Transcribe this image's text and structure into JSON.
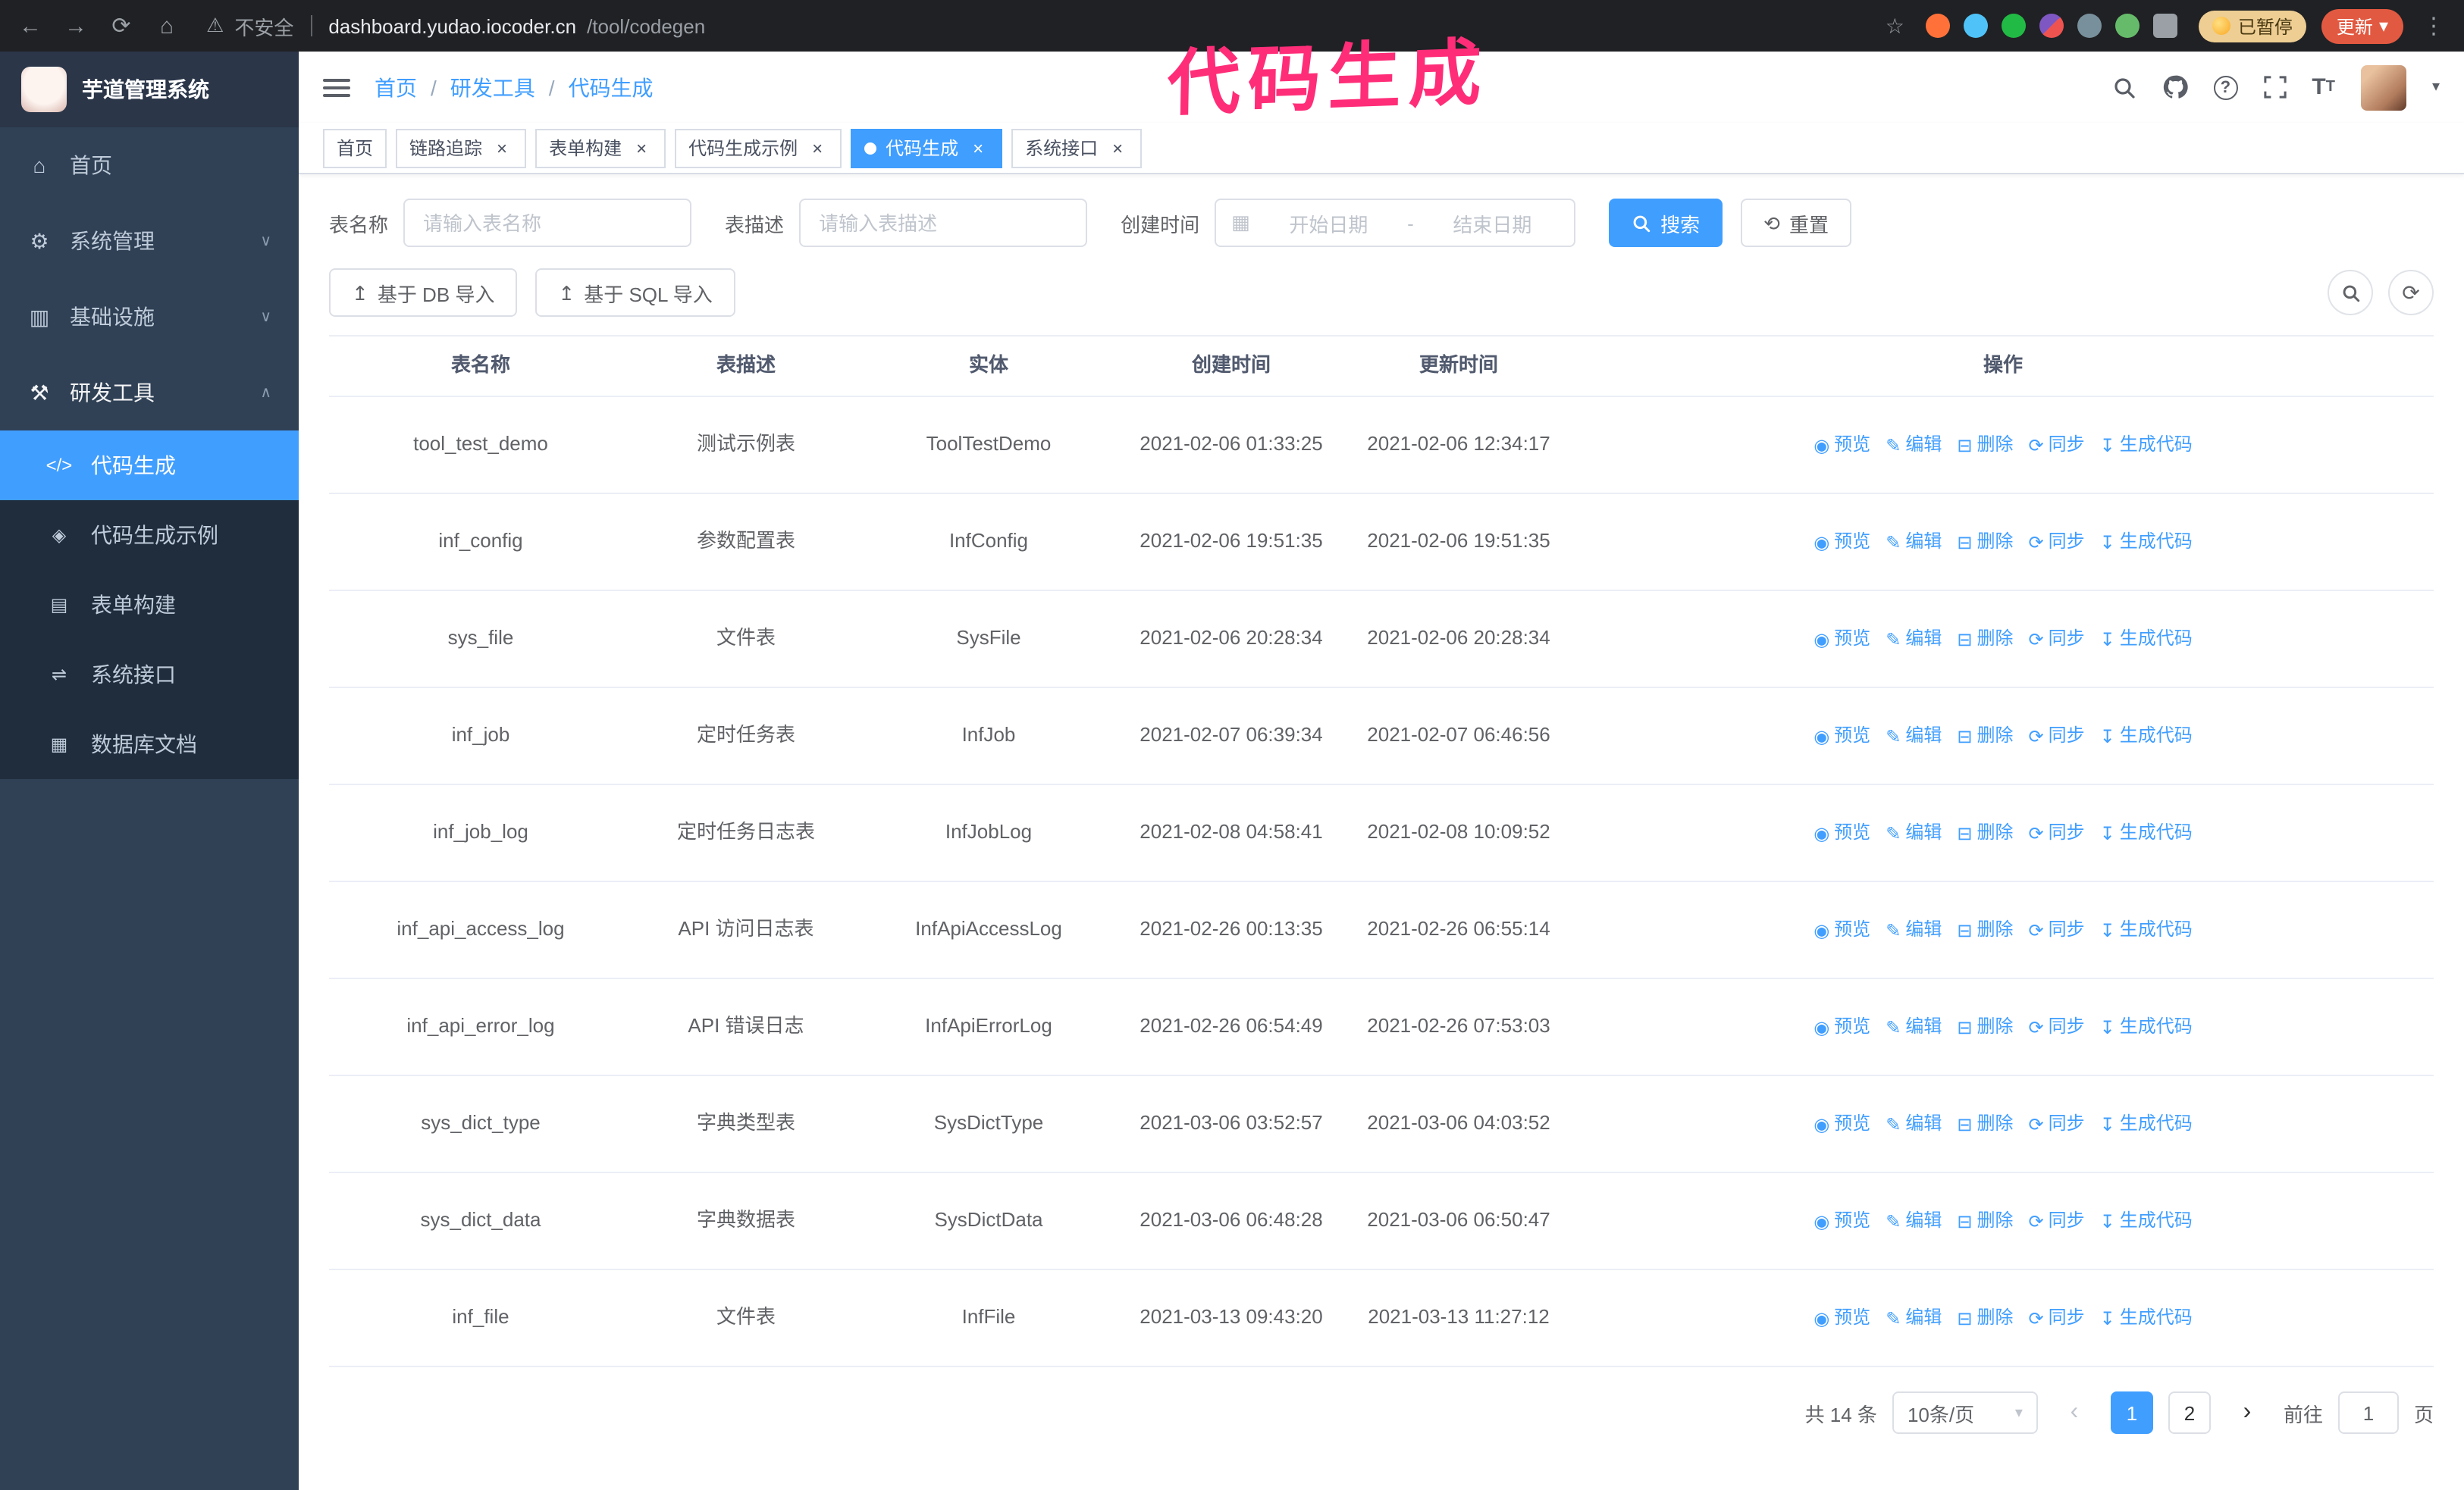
{
  "browser": {
    "security_label": "不安全",
    "url_domain": "dashboard.yudao.iocoder.cn",
    "url_path": "/tool/codegen",
    "paused_badge": "已暂停",
    "update_button": "更新"
  },
  "annotation": "代码生成",
  "icons": {
    "back": "←",
    "forward": "→",
    "reload": "⟳",
    "home": "⌂",
    "warning": "⚠",
    "star": "☆",
    "kebab": "⋮",
    "help": "?",
    "menu_home": "⌂",
    "menu_system": "⚙",
    "menu_infra": "▥",
    "menu_tools": "⚒",
    "chev_down": "∨",
    "chev_up": "∧",
    "sub_codegen": "</>",
    "sub_demo": "◈",
    "sub_form": "▤",
    "sub_api": "⇌",
    "sub_db": "▦",
    "calendar": "▦",
    "reset": "⟲",
    "upload": "↥",
    "caret_down": "▾",
    "close": "×",
    "prev": "‹",
    "next": "›",
    "fontsize": "T",
    "eye": "◉",
    "edit": "✎",
    "trash": "⊟",
    "sync": "⟳",
    "download": "↧"
  },
  "sidebar": {
    "logo_title": "芋道管理系统",
    "items": [
      {
        "label": "首页"
      },
      {
        "label": "系统管理"
      },
      {
        "label": "基础设施"
      },
      {
        "label": "研发工具"
      }
    ],
    "subitems": [
      {
        "label": "代码生成"
      },
      {
        "label": "代码生成示例"
      },
      {
        "label": "表单构建"
      },
      {
        "label": "系统接口"
      },
      {
        "label": "数据库文档"
      }
    ]
  },
  "breadcrumb": [
    "首页",
    "研发工具",
    "代码生成"
  ],
  "tabs": [
    {
      "label": "首页"
    },
    {
      "label": "链路追踪"
    },
    {
      "label": "表单构建"
    },
    {
      "label": "代码生成示例"
    },
    {
      "label": "代码生成"
    },
    {
      "label": "系统接口"
    }
  ],
  "filters": {
    "table_name_label": "表名称",
    "table_name_placeholder": "请输入表名称",
    "table_desc_label": "表描述",
    "table_desc_placeholder": "请输入表描述",
    "create_time_label": "创建时间",
    "date_start_placeholder": "开始日期",
    "date_separator": "-",
    "date_end_placeholder": "结束日期",
    "search_button": "搜索",
    "reset_button": "重置"
  },
  "toolbar": {
    "import_db_button": "基于 DB 导入",
    "import_sql_button": "基于 SQL 导入"
  },
  "table": {
    "columns": [
      "表名称",
      "表描述",
      "实体",
      "创建时间",
      "更新时间",
      "操作"
    ],
    "actions": [
      {
        "label": "预览",
        "icon": "eye"
      },
      {
        "label": "编辑",
        "icon": "edit"
      },
      {
        "label": "删除",
        "icon": "trash"
      },
      {
        "label": "同步",
        "icon": "sync"
      },
      {
        "label": "生成代码",
        "icon": "download"
      }
    ],
    "rows": [
      [
        "tool_test_demo",
        "测试示例表",
        "ToolTestDemo",
        "2021-02-06 01:33:25",
        "2021-02-06 12:34:17"
      ],
      [
        "inf_config",
        "参数配置表",
        "InfConfig",
        "2021-02-06 19:51:35",
        "2021-02-06 19:51:35"
      ],
      [
        "sys_file",
        "文件表",
        "SysFile",
        "2021-02-06 20:28:34",
        "2021-02-06 20:28:34"
      ],
      [
        "inf_job",
        "定时任务表",
        "InfJob",
        "2021-02-07 06:39:34",
        "2021-02-07 06:46:56"
      ],
      [
        "inf_job_log",
        "定时任务日志表",
        "InfJobLog",
        "2021-02-08 04:58:41",
        "2021-02-08 10:09:52"
      ],
      [
        "inf_api_access_log",
        "API 访问日志表",
        "InfApiAccessLog",
        "2021-02-26 00:13:35",
        "2021-02-26 06:55:14"
      ],
      [
        "inf_api_error_log",
        "API 错误日志",
        "InfApiErrorLog",
        "2021-02-26 06:54:49",
        "2021-02-26 07:53:03"
      ],
      [
        "sys_dict_type",
        "字典类型表",
        "SysDictType",
        "2021-03-06 03:52:57",
        "2021-03-06 04:03:52"
      ],
      [
        "sys_dict_data",
        "字典数据表",
        "SysDictData",
        "2021-03-06 06:48:28",
        "2021-03-06 06:50:47"
      ],
      [
        "inf_file",
        "文件表",
        "InfFile",
        "2021-03-13 09:43:20",
        "2021-03-13 11:27:12"
      ]
    ]
  },
  "pagination": {
    "total": "共 14 条",
    "page_size": "10条/页",
    "pages": [
      "1",
      "2"
    ],
    "goto_label": "前往",
    "goto_value": "1",
    "goto_suffix": "页"
  }
}
